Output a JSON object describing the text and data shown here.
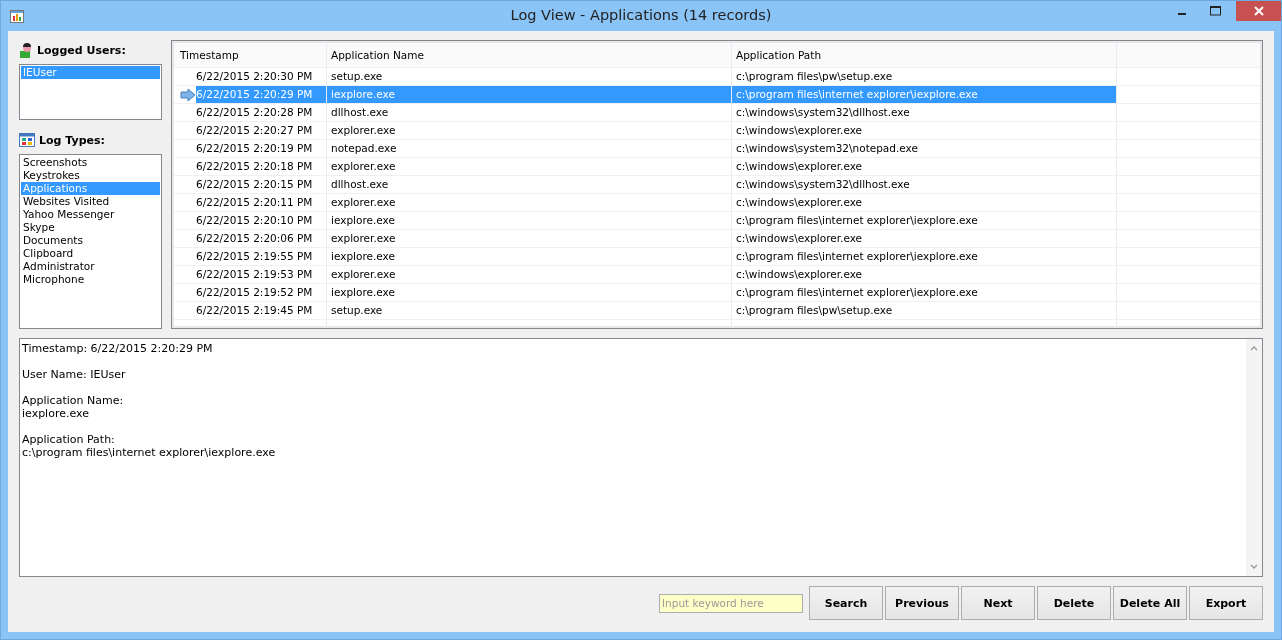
{
  "window": {
    "title": "Log View - Applications (14 records)"
  },
  "users": {
    "heading": "Logged Users:",
    "items": [
      {
        "label": "IEUser",
        "selected": true
      }
    ]
  },
  "log_types": {
    "heading": "Log Types:",
    "items": [
      {
        "label": "Screenshots",
        "selected": false
      },
      {
        "label": "Keystrokes",
        "selected": false
      },
      {
        "label": "Applications",
        "selected": true
      },
      {
        "label": "Websites Visited",
        "selected": false
      },
      {
        "label": "Yahoo Messenger",
        "selected": false
      },
      {
        "label": "Skype",
        "selected": false
      },
      {
        "label": "Documents",
        "selected": false
      },
      {
        "label": "Clipboard",
        "selected": false
      },
      {
        "label": "Administrator",
        "selected": false
      },
      {
        "label": "Microphone",
        "selected": false
      }
    ]
  },
  "table": {
    "columns": [
      "Timestamp",
      "Application Name",
      "Application Path"
    ],
    "rows": [
      {
        "cells": [
          "6/22/2015 2:20:30 PM",
          "setup.exe",
          "c:\\program files\\pw\\setup.exe"
        ],
        "selected": false
      },
      {
        "cells": [
          "6/22/2015 2:20:29 PM",
          "iexplore.exe",
          "c:\\program files\\internet explorer\\iexplore.exe"
        ],
        "selected": true
      },
      {
        "cells": [
          "6/22/2015 2:20:28 PM",
          "dllhost.exe",
          "c:\\windows\\system32\\dllhost.exe"
        ],
        "selected": false
      },
      {
        "cells": [
          "6/22/2015 2:20:27 PM",
          "explorer.exe",
          "c:\\windows\\explorer.exe"
        ],
        "selected": false
      },
      {
        "cells": [
          "6/22/2015 2:20:19 PM",
          "notepad.exe",
          "c:\\windows\\system32\\notepad.exe"
        ],
        "selected": false
      },
      {
        "cells": [
          "6/22/2015 2:20:18 PM",
          "explorer.exe",
          "c:\\windows\\explorer.exe"
        ],
        "selected": false
      },
      {
        "cells": [
          "6/22/2015 2:20:15 PM",
          "dllhost.exe",
          "c:\\windows\\system32\\dllhost.exe"
        ],
        "selected": false
      },
      {
        "cells": [
          "6/22/2015 2:20:11 PM",
          "explorer.exe",
          "c:\\windows\\explorer.exe"
        ],
        "selected": false
      },
      {
        "cells": [
          "6/22/2015 2:20:10 PM",
          "iexplore.exe",
          "c:\\program files\\internet explorer\\iexplore.exe"
        ],
        "selected": false
      },
      {
        "cells": [
          "6/22/2015 2:20:06 PM",
          "explorer.exe",
          "c:\\windows\\explorer.exe"
        ],
        "selected": false
      },
      {
        "cells": [
          "6/22/2015 2:19:55 PM",
          "iexplore.exe",
          "c:\\program files\\internet explorer\\iexplore.exe"
        ],
        "selected": false
      },
      {
        "cells": [
          "6/22/2015 2:19:53 PM",
          "explorer.exe",
          "c:\\windows\\explorer.exe"
        ],
        "selected": false
      },
      {
        "cells": [
          "6/22/2015 2:19:52 PM",
          "iexplore.exe",
          "c:\\program files\\internet explorer\\iexplore.exe"
        ],
        "selected": false
      },
      {
        "cells": [
          "6/22/2015 2:19:45 PM",
          "setup.exe",
          "c:\\program files\\pw\\setup.exe"
        ],
        "selected": false
      }
    ]
  },
  "detail": [
    "Timestamp: 6/22/2015 2:20:29 PM",
    "User Name: IEUser",
    "Application Name:\niexplore.exe",
    "Application Path:\nc:\\program files\\internet explorer\\iexplore.exe"
  ],
  "search": {
    "placeholder": "Input keyword here"
  },
  "buttons": [
    "Search",
    "Previous",
    "Next",
    "Delete",
    "Delete All",
    "Export"
  ]
}
